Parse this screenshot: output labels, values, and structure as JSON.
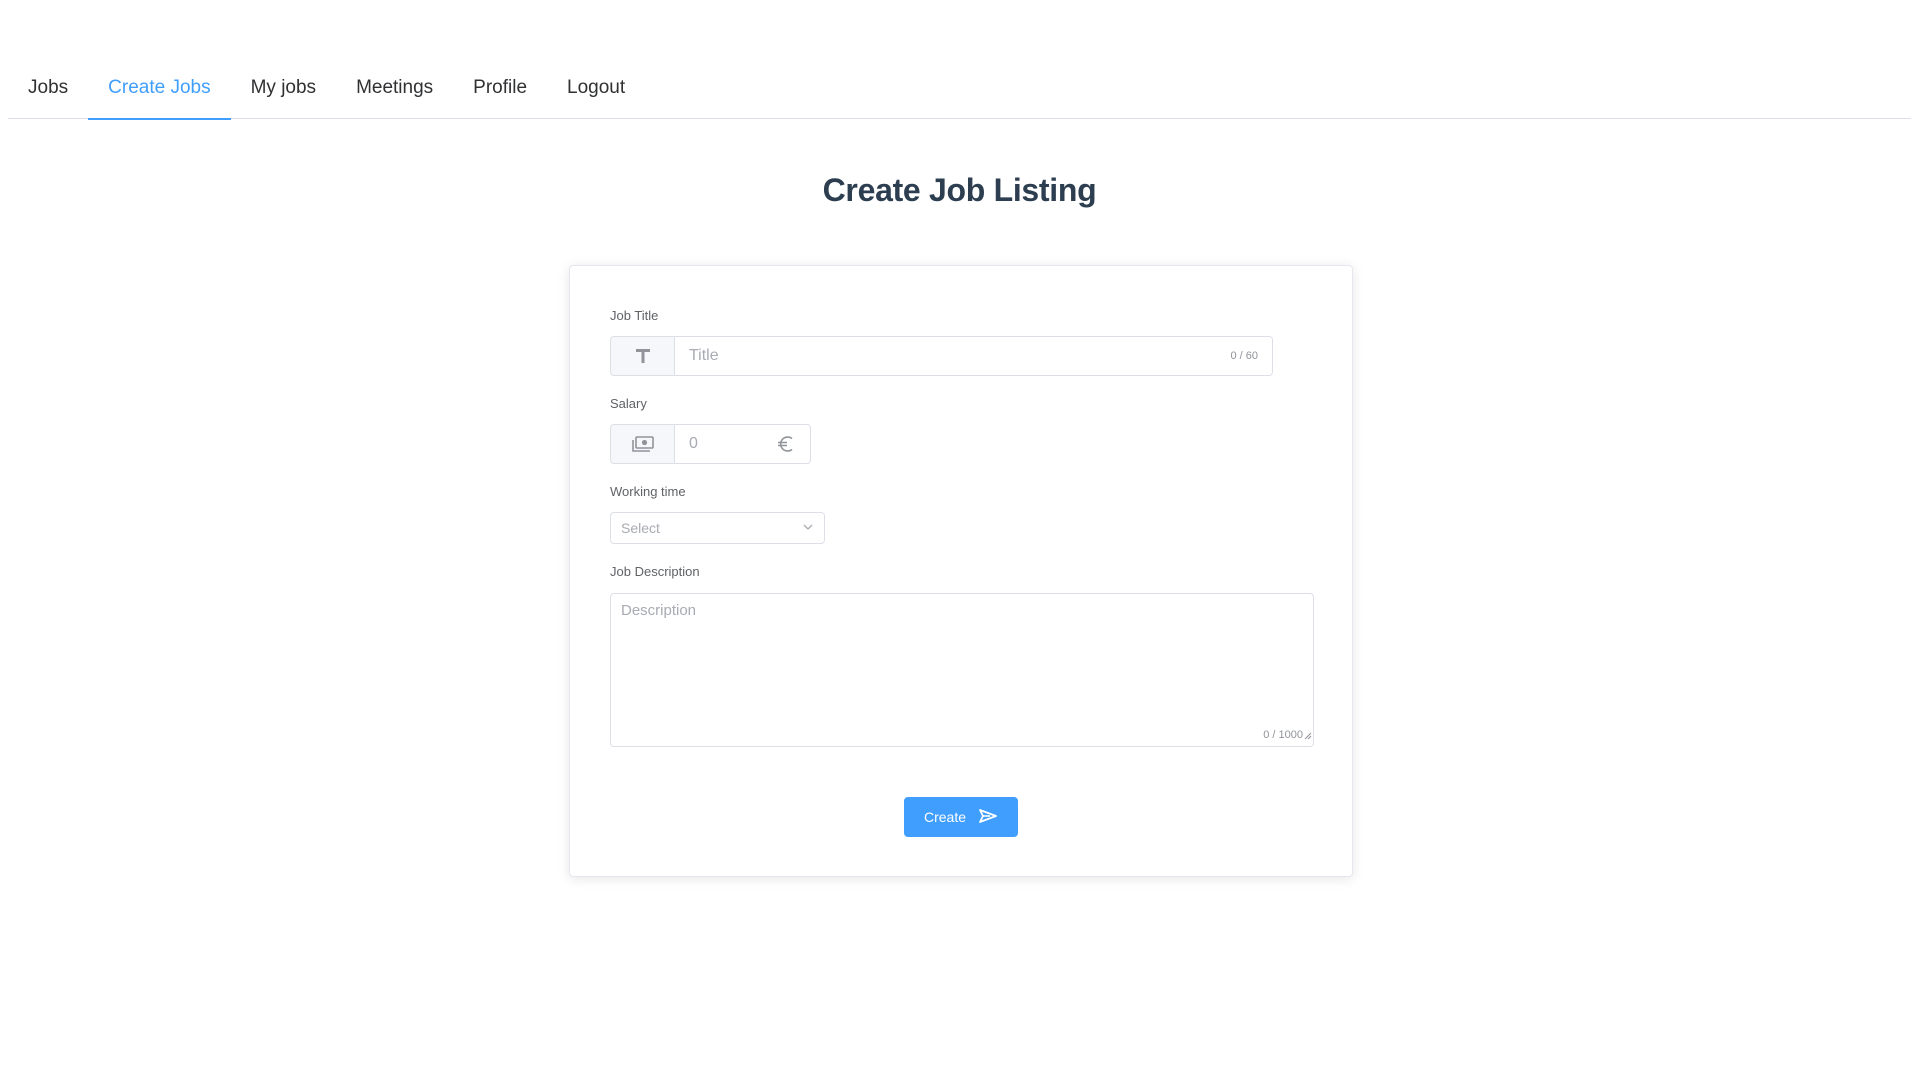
{
  "nav": {
    "items": [
      {
        "label": "Jobs",
        "active": false
      },
      {
        "label": "Create Jobs",
        "active": true
      },
      {
        "label": "My jobs",
        "active": false
      },
      {
        "label": "Meetings",
        "active": false
      },
      {
        "label": "Profile",
        "active": false
      },
      {
        "label": "Logout",
        "active": false
      }
    ]
  },
  "page": {
    "title": "Create Job Listing"
  },
  "form": {
    "job_title": {
      "label": "Job Title",
      "value": "",
      "placeholder": "Title",
      "counter": "0 / 60",
      "icon": "text-t-icon"
    },
    "salary": {
      "label": "Salary",
      "value": "",
      "placeholder": "0",
      "icon": "money-icon",
      "suffix_icon": "euro-icon"
    },
    "working_time": {
      "label": "Working time",
      "selected": "Select"
    },
    "description": {
      "label": "Job Description",
      "value": "",
      "placeholder": "Description",
      "counter": "0 / 1000"
    },
    "submit": {
      "label": "Create",
      "icon": "send-icon"
    }
  },
  "colors": {
    "accent": "#409eff",
    "title": "#2c3e50",
    "border": "#dcdfe6"
  }
}
